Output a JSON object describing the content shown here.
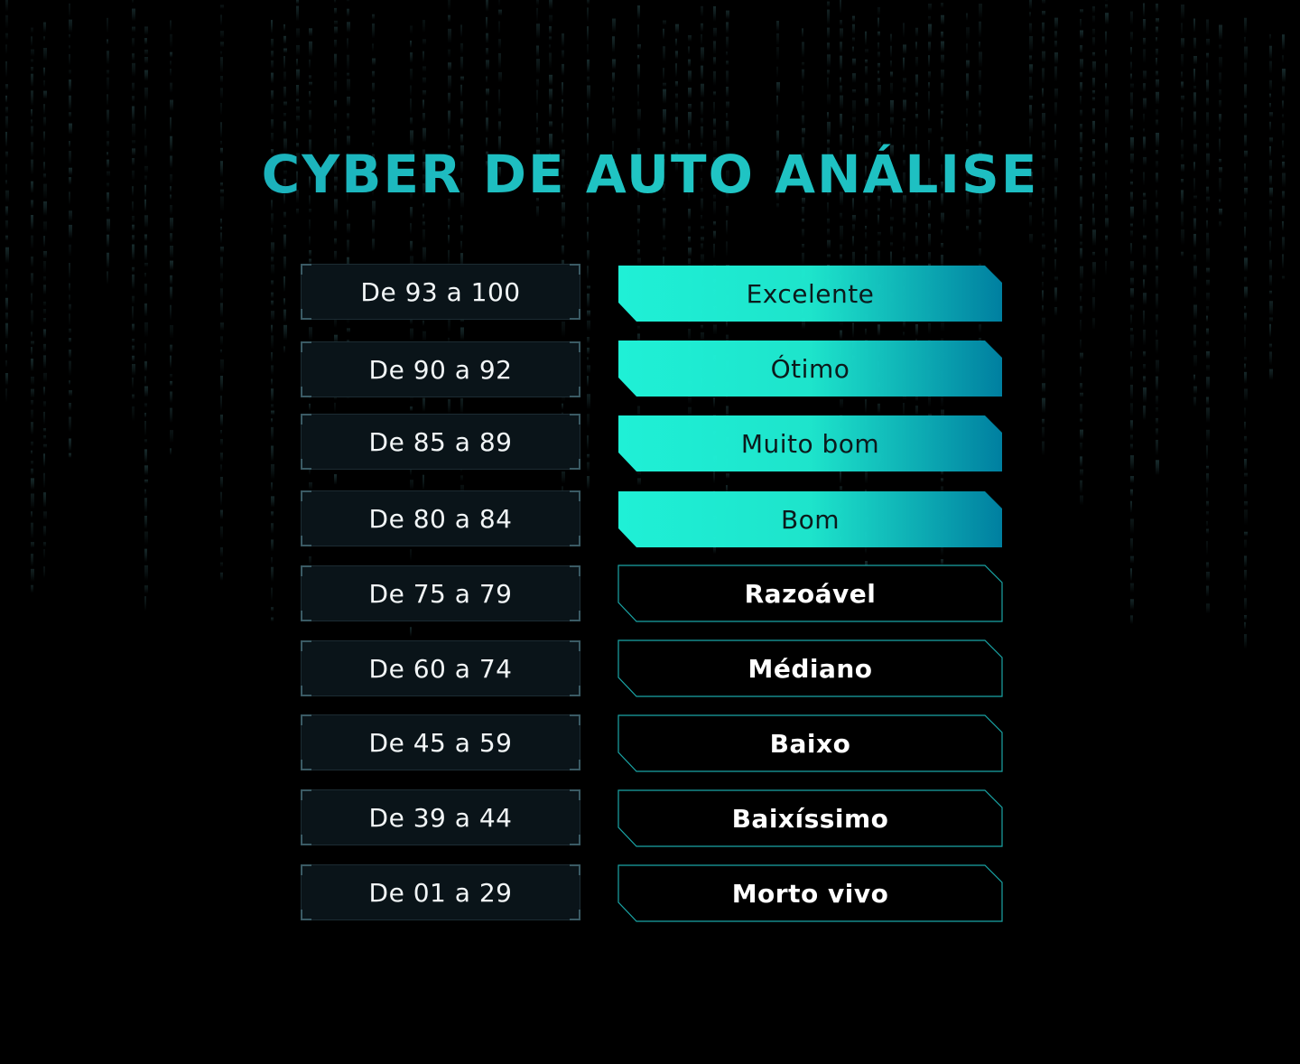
{
  "title": "CYBER DE AUTO ANÁLISE",
  "colors": {
    "background": "#000000",
    "title": "#1fb5bf",
    "filled_start": "#1ff0d6",
    "filled_end": "#007fa0",
    "outline": "#1aa5a6",
    "range_box_bg": "#0a1419"
  },
  "rows": [
    {
      "range": "De 93 a 100",
      "label": "Excelente",
      "highlighted": true
    },
    {
      "range": "De 90 a 92",
      "label": "Ótimo",
      "highlighted": true
    },
    {
      "range": "De 85 a 89",
      "label": "Muito bom",
      "highlighted": true
    },
    {
      "range": "De 80 a 84",
      "label": "Bom",
      "highlighted": true
    },
    {
      "range": "De 75 a 79",
      "label": "Razoável",
      "highlighted": false
    },
    {
      "range": "De 60 a 74",
      "label": "Médiano",
      "highlighted": false
    },
    {
      "range": "De 45 a 59",
      "label": "Baixo",
      "highlighted": false
    },
    {
      "range": "De 39 a 44",
      "label": "Baixíssimo",
      "highlighted": false
    },
    {
      "range": "De 01 a 29",
      "label": "Morto vivo",
      "highlighted": false
    }
  ]
}
